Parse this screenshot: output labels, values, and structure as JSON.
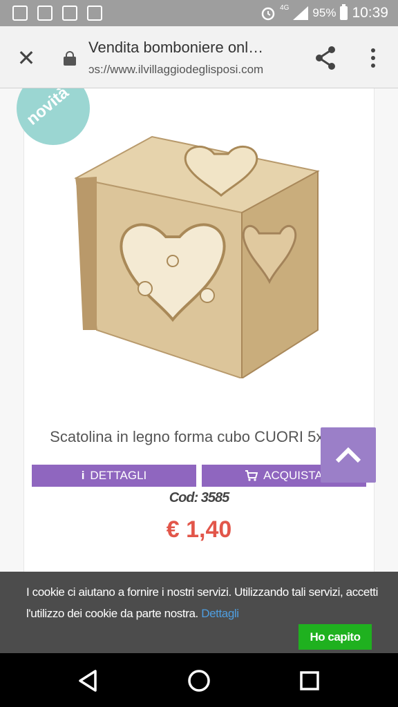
{
  "status_bar": {
    "network": "4G",
    "battery_percent": "95%",
    "time": "10:39"
  },
  "browser": {
    "page_title": "Vendita bomboniere onl…",
    "url": "ɔs://www.ilvillaggiodeglisposi.com"
  },
  "product": {
    "badge": "novità",
    "title": "Scatolina in legno forma cubo CUORI 5x5x5",
    "code": "Cod: 3585",
    "price": "€ 1,40",
    "details_label": "DETTAGLI",
    "buy_label": "ACQUISTA"
  },
  "cookie_banner": {
    "text": "I cookie ci aiutano a fornire i nostri servizi. Utilizzando tali servizi, accetti l'utilizzo dei cookie da parte nostra.",
    "link_label": "Dettagli",
    "accept_label": "Ho capito",
    "link_color": "#4f9ee0",
    "accept_color": "#1fb11f"
  },
  "colors": {
    "accent_purple": "#8f66bf",
    "price_red": "#e2564a",
    "badge_teal": "#9bd6d2"
  },
  "icons": [
    "sync-icon",
    "chat-icon",
    "image-icon",
    "mail-icon",
    "alarm-icon",
    "signal-icon",
    "battery-icon",
    "close-icon",
    "lock-icon",
    "share-icon",
    "more-vert-icon",
    "info-icon",
    "cart-icon",
    "chevron-up-icon",
    "back-icon",
    "home-icon",
    "recents-icon"
  ]
}
